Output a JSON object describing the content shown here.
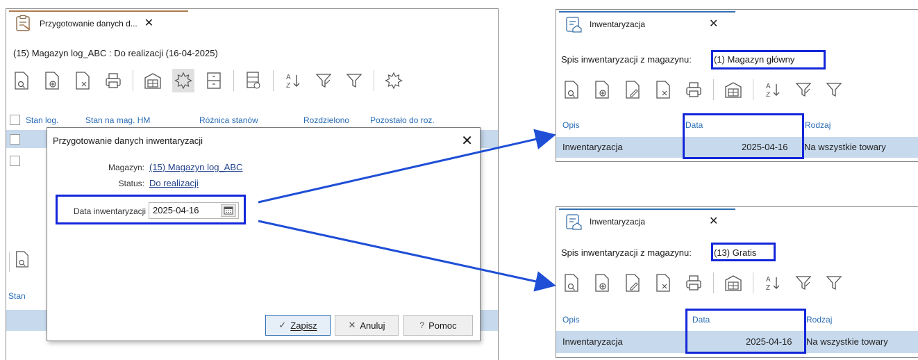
{
  "main_window": {
    "tab_label": "Przygotowanie danych d...",
    "breadcrumb": "(15) Magazyn log_ABC : Do realizacji (16-04-2025)",
    "columns": [
      "Stan log.",
      "Stan na mag. HM",
      "Różnica stanów",
      "Rozdzielono",
      "Pozostało do roz."
    ],
    "lower_column": "Stan"
  },
  "dialog": {
    "title": "Przygotowanie danych inwentaryzacji",
    "magazyn_label": "Magazyn:",
    "magazyn_value": "(15) Magazyn log_ABC",
    "status_label": "Status:",
    "status_value": "Do realizacji",
    "date_label": "Data inwentaryzacji",
    "date_value": "2025-04-16",
    "buttons": {
      "save": "Zapisz",
      "cancel": "Anuluj",
      "help": "Pomoc"
    }
  },
  "right_top": {
    "tab_label": "Inwentaryzacja",
    "spis_label": "Spis inwentaryzacji z magazynu:",
    "spis_value": "(1) Magazyn główny",
    "headers": [
      "Opis",
      "Data",
      "Rodzaj"
    ],
    "row": [
      "Inwentaryzacja",
      "2025-04-16",
      "Na wszystkie towary"
    ]
  },
  "right_bottom": {
    "tab_label": "Inwentaryzacja",
    "spis_label": "Spis inwentaryzacji z magazynu:",
    "spis_value": "(13) Gratis",
    "headers": [
      "Opis",
      "Data",
      "Rodzaj"
    ],
    "row": [
      "Inwentaryzacja",
      "2025-04-16",
      "Na wszystkie towary"
    ]
  },
  "colors": {
    "highlight": "#1226d9",
    "link_blue": "#2a6db5",
    "row_selected": "#c7d9ec",
    "main_tab_accent": "#b07a4f",
    "right_tab_accent": "#2f6fb0"
  }
}
